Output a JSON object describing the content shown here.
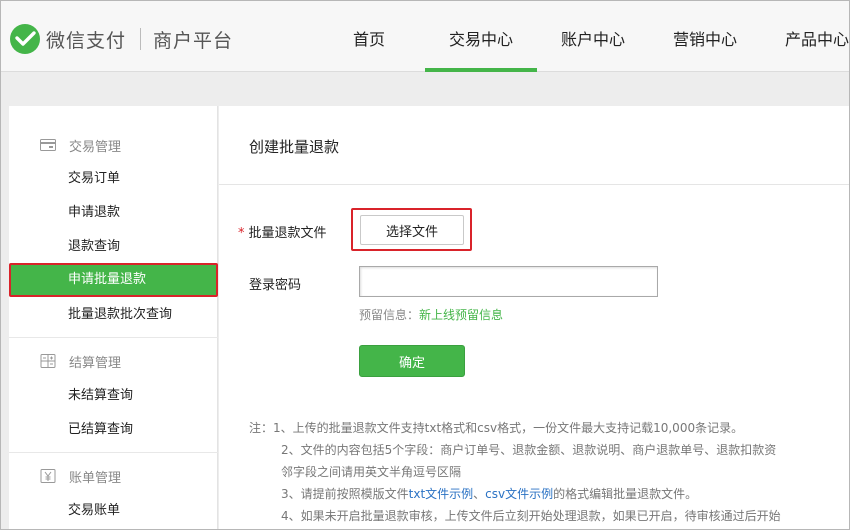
{
  "header": {
    "brand": "微信支付",
    "sub_brand": "商户平台",
    "nav": [
      {
        "label": "首页"
      },
      {
        "label": "交易中心"
      },
      {
        "label": "账户中心"
      },
      {
        "label": "营销中心"
      },
      {
        "label": "产品中心"
      }
    ],
    "active_nav": "交易中心"
  },
  "sidebar": {
    "sections": [
      {
        "title": "交易管理",
        "icon": "card-icon",
        "items": [
          "交易订单",
          "申请退款",
          "退款查询",
          "申请批量退款",
          "批量退款批次查询"
        ]
      },
      {
        "title": "结算管理",
        "icon": "calculator-icon",
        "items": [
          "未结算查询",
          "已结算查询"
        ]
      },
      {
        "title": "账单管理",
        "icon": "yen-icon",
        "items": [
          "交易账单"
        ]
      }
    ],
    "active_item": "申请批量退款"
  },
  "main": {
    "title": "创建批量退款",
    "file_label": "批量退款文件",
    "required_mark": "*",
    "file_button": "选择文件",
    "password_label": "登录密码",
    "password_value": "",
    "hint_prefix": "预留信息：",
    "hint_link": "新上线预留信息",
    "submit_button": "确定",
    "notes": {
      "n1": "注：1、上传的批量退款文件支持txt格式和csv格式，一份文件最大支持记载10,000条记录。",
      "n2": "2、文件的内容包括5个字段：商户订单号、退款金额、退款说明、商户退款单号、退款扣款资",
      "n2b": "邻字段之间请用英文半角逗号区隔",
      "n3_prefix": "3、请提前按照模版文件",
      "n3_link1": "txt文件示例",
      "n3_sep": "、",
      "n3_link2": "csv文件示例",
      "n3_suffix": "的格式编辑批量退款文件。",
      "n4": "4、如果未开启批量退款审核，上传文件后立刻开始处理退款，如果已开启，待审核通过后开始"
    }
  },
  "colors": {
    "accent": "#44b549",
    "highlight": "#d9232a",
    "link": "#2a72c4"
  }
}
